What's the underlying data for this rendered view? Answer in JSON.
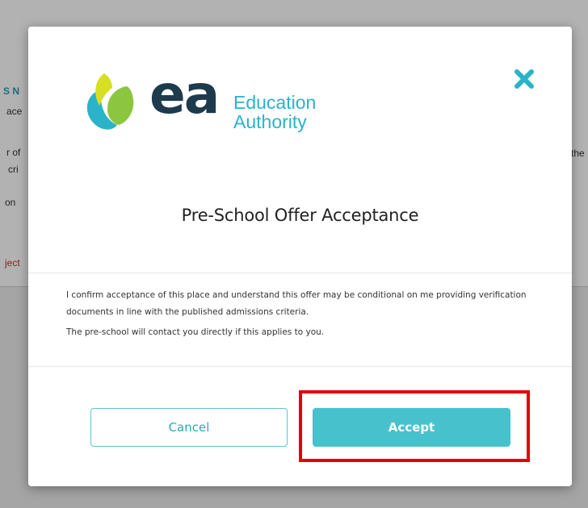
{
  "background": {
    "fragments": [
      "S N",
      "ace",
      "r of",
      "cri",
      "on",
      "ject",
      "the"
    ]
  },
  "modal": {
    "logo": {
      "mark": "ea",
      "name_line1": "Education",
      "name_line2": "Authority"
    },
    "close_icon": "close-x-icon",
    "title": "Pre-School Offer Acceptance",
    "body": {
      "paragraph1": "I confirm acceptance of this place and understand this offer may be conditional on me providing verification documents in line with the published admissions criteria.",
      "paragraph2": "The pre-school will contact you directly if this applies to you."
    },
    "buttons": {
      "cancel_label": "Cancel",
      "accept_label": "Accept"
    }
  },
  "colors": {
    "accent": "#47c2cd",
    "logo_dark": "#1e3a4d",
    "logo_green": "#8cc63f",
    "logo_yellow": "#d7df23",
    "logo_teal": "#2ab3c9",
    "highlight": "#e50000"
  }
}
